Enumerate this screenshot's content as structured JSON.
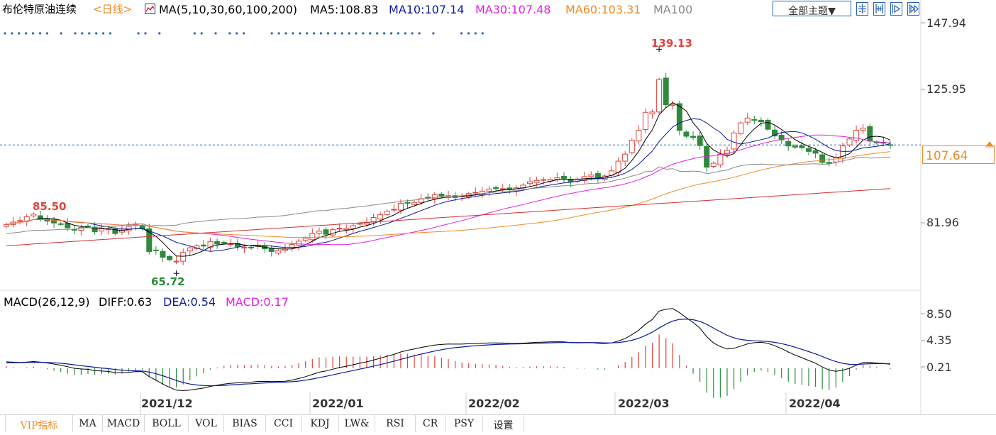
{
  "header": {
    "instrument": "布伦特原油连续",
    "period": "<日线>",
    "ma_title": "MA(5,10,30,60,100,200)",
    "ma5": "MA5:108.83",
    "ma10": "MA10:107.14",
    "ma30": "MA30:107.48",
    "ma60": "MA60:103.31",
    "ma100": "MA100",
    "theme_button": "全部主题▼"
  },
  "price_axis": [
    "147.94",
    "125.95",
    "81.96"
  ],
  "current_price": "107.64",
  "annotations": {
    "high": "139.13",
    "left_high": "85.50",
    "low": "65.72"
  },
  "macd_header": {
    "title": "MACD(26,12,9)",
    "diff": "DIFF:0.63",
    "dea": "DEA:0.54",
    "macd": "MACD:0.17"
  },
  "macd_axis": [
    "8.50",
    "4.35",
    "0.21"
  ],
  "x_labels": [
    "2021/12",
    "2022/01",
    "2022/02",
    "2022/03",
    "2022/04"
  ],
  "tabs": [
    "VIP指标",
    "MA",
    "MACD",
    "BOLL",
    "VOL",
    "BIAS",
    "CCI",
    "KDJ",
    "LW&",
    "RSI",
    "CR",
    "PSY",
    "设置"
  ],
  "colors": {
    "up": "#e0413a",
    "down": "#2e8a3a",
    "ma5": "#000000",
    "ma10": "#0a1a9c",
    "ma30": "#e020e0",
    "ma60": "#f08a24",
    "ma100": "#888888",
    "ma200": "#d03030",
    "accent": "#2a62b8"
  },
  "icons": [
    "ma-indicator-icon",
    "layout-grid-icon",
    "layout-split-icon",
    "play-icon",
    "forward-icon",
    "up-arrow-icon"
  ],
  "chart_data": {
    "type": "candlestick",
    "title": "布伦特原油连续",
    "y_ticks": [
      147.94,
      125.95,
      81.96
    ],
    "months": [
      "2021/12",
      "2022/01",
      "2022/02",
      "2022/03",
      "2022/04"
    ],
    "high": 139.13,
    "low": 65.72,
    "last": 107.64,
    "ma_last": {
      "MA5": 108.83,
      "MA10": 107.14,
      "MA30": 107.48,
      "MA60": 103.31
    },
    "closes": [
      81.4,
      82.2,
      82.7,
      84.0,
      84.8,
      83.2,
      82.5,
      81.9,
      81.6,
      80.3,
      79.5,
      80.4,
      80.8,
      79.0,
      80.2,
      79.9,
      78.4,
      79.6,
      80.8,
      81.5,
      80.0,
      72.5,
      72.8,
      70.6,
      69.8,
      69.3,
      72.2,
      73.7,
      74.4,
      74.3,
      75.8,
      75.0,
      75.2,
      75.0,
      74.1,
      73.9,
      73.7,
      74.5,
      73.4,
      72.5,
      72.9,
      73.3,
      74.8,
      75.9,
      76.9,
      78.5,
      79.2,
      78.2,
      79.7,
      80.2,
      80.1,
      81.0,
      81.8,
      82.1,
      83.7,
      84.7,
      85.8,
      86.4,
      88.4,
      88.5,
      88.7,
      89.9,
      90.2,
      91.2,
      90.8,
      90.9,
      90.3,
      90.8,
      91.6,
      92.0,
      92.4,
      93.1,
      93.2,
      93.2,
      92.9,
      93.5,
      94.4,
      95.5,
      95.9,
      96.2,
      96.3,
      96.8,
      96.6,
      95.4,
      96.4,
      97.2,
      97.7,
      96.5,
      97.4,
      99.1,
      102.3,
      104.6,
      109.2,
      112.5,
      118.4,
      118.5,
      129.2,
      120.9,
      121.0,
      112.4,
      110.5,
      110.1,
      107.4,
      100.3,
      101.6,
      104.6,
      105.8,
      111.6,
      114.9,
      116.5,
      115.8,
      115.3,
      112.8,
      110.6,
      109.3,
      107.3,
      106.9,
      106.7,
      105.5,
      104.9,
      101.9,
      101.5,
      103.5,
      107.4,
      109.6,
      112.5,
      113.2,
      108.9,
      108.3,
      108.2,
      107.6
    ],
    "macd": {
      "DIFF": 0.63,
      "DEA": 0.54,
      "MACD": 0.17,
      "y_ticks": [
        8.5,
        4.35,
        0.21
      ],
      "diff_series": [
        1.0,
        0.94,
        0.9,
        0.96,
        1.04,
        0.96,
        0.82,
        0.65,
        0.48,
        0.24,
        -0.01,
        -0.12,
        -0.17,
        -0.38,
        -0.44,
        -0.5,
        -0.68,
        -0.72,
        -0.64,
        -0.52,
        -0.54,
        -1.3,
        -1.86,
        -2.46,
        -2.98,
        -3.41,
        -3.48,
        -3.4,
        -3.24,
        -3.09,
        -2.83,
        -2.65,
        -2.48,
        -2.34,
        -2.28,
        -2.22,
        -2.17,
        -2.06,
        -2.04,
        -2.08,
        -2.06,
        -2.02,
        -1.85,
        -1.6,
        -1.32,
        -0.96,
        -0.62,
        -0.43,
        -0.15,
        0.11,
        0.31,
        0.54,
        0.78,
        0.99,
        1.27,
        1.56,
        1.87,
        2.16,
        2.53,
        2.8,
        3.01,
        3.24,
        3.41,
        3.6,
        3.7,
        3.77,
        3.76,
        3.76,
        3.81,
        3.85,
        3.88,
        3.93,
        3.94,
        3.92,
        3.88,
        3.87,
        3.9,
        3.97,
        4.03,
        4.07,
        4.1,
        4.12,
        4.11,
        4.0,
        3.96,
        3.97,
        3.99,
        3.88,
        3.85,
        3.94,
        4.24,
        4.62,
        5.23,
        5.92,
        6.88,
        7.59,
        8.9,
        9.19,
        9.3,
        8.65,
        7.86,
        7.13,
        6.24,
        4.92,
        3.94,
        3.38,
        2.99,
        3.11,
        3.44,
        3.79,
        3.98,
        4.06,
        3.87,
        3.5,
        3.07,
        2.53,
        2.05,
        1.64,
        1.2,
        0.78,
        0.19,
        -0.28,
        -0.48,
        -0.32,
        -0.0,
        0.48,
        0.91,
        0.89,
        0.81,
        0.73,
        0.63
      ],
      "dea_series": [
        0.85,
        0.86,
        0.87,
        0.89,
        0.92,
        0.92,
        0.9,
        0.85,
        0.77,
        0.66,
        0.53,
        0.4,
        0.28,
        0.15,
        0.03,
        -0.07,
        -0.2,
        -0.3,
        -0.37,
        -0.4,
        -0.43,
        -0.6,
        -0.85,
        -1.17,
        -1.53,
        -1.91,
        -2.22,
        -2.46,
        -2.61,
        -2.7,
        -2.73,
        -2.71,
        -2.67,
        -2.6,
        -2.54,
        -2.47,
        -2.42,
        -2.35,
        -2.29,
        -2.24,
        -2.2,
        -2.17,
        -2.1,
        -2.0,
        -1.86,
        -1.68,
        -1.47,
        -1.26,
        -1.04,
        -0.81,
        -0.59,
        -0.36,
        -0.13,
        0.09,
        0.33,
        0.57,
        0.83,
        1.1,
        1.38,
        1.67,
        1.94,
        2.2,
        2.44,
        2.67,
        2.88,
        3.06,
        3.2,
        3.31,
        3.41,
        3.5,
        3.57,
        3.64,
        3.7,
        3.74,
        3.77,
        3.79,
        3.81,
        3.84,
        3.88,
        3.92,
        3.95,
        3.99,
        4.01,
        4.01,
        4.0,
        4.0,
        4.0,
        3.98,
        3.95,
        3.95,
        4.01,
        4.13,
        4.35,
        4.67,
        5.11,
        5.61,
        6.27,
        6.86,
        7.35,
        7.61,
        7.66,
        7.56,
        7.3,
        6.83,
        6.25,
        5.68,
        5.14,
        4.74,
        4.48,
        4.34,
        4.27,
        4.23,
        4.16,
        4.03,
        3.84,
        3.58,
        3.27,
        2.94,
        2.59,
        2.23,
        1.82,
        1.4,
        1.03,
        0.76,
        0.61,
        0.58,
        0.65,
        0.7,
        0.72,
        0.72,
        0.7
      ]
    }
  }
}
